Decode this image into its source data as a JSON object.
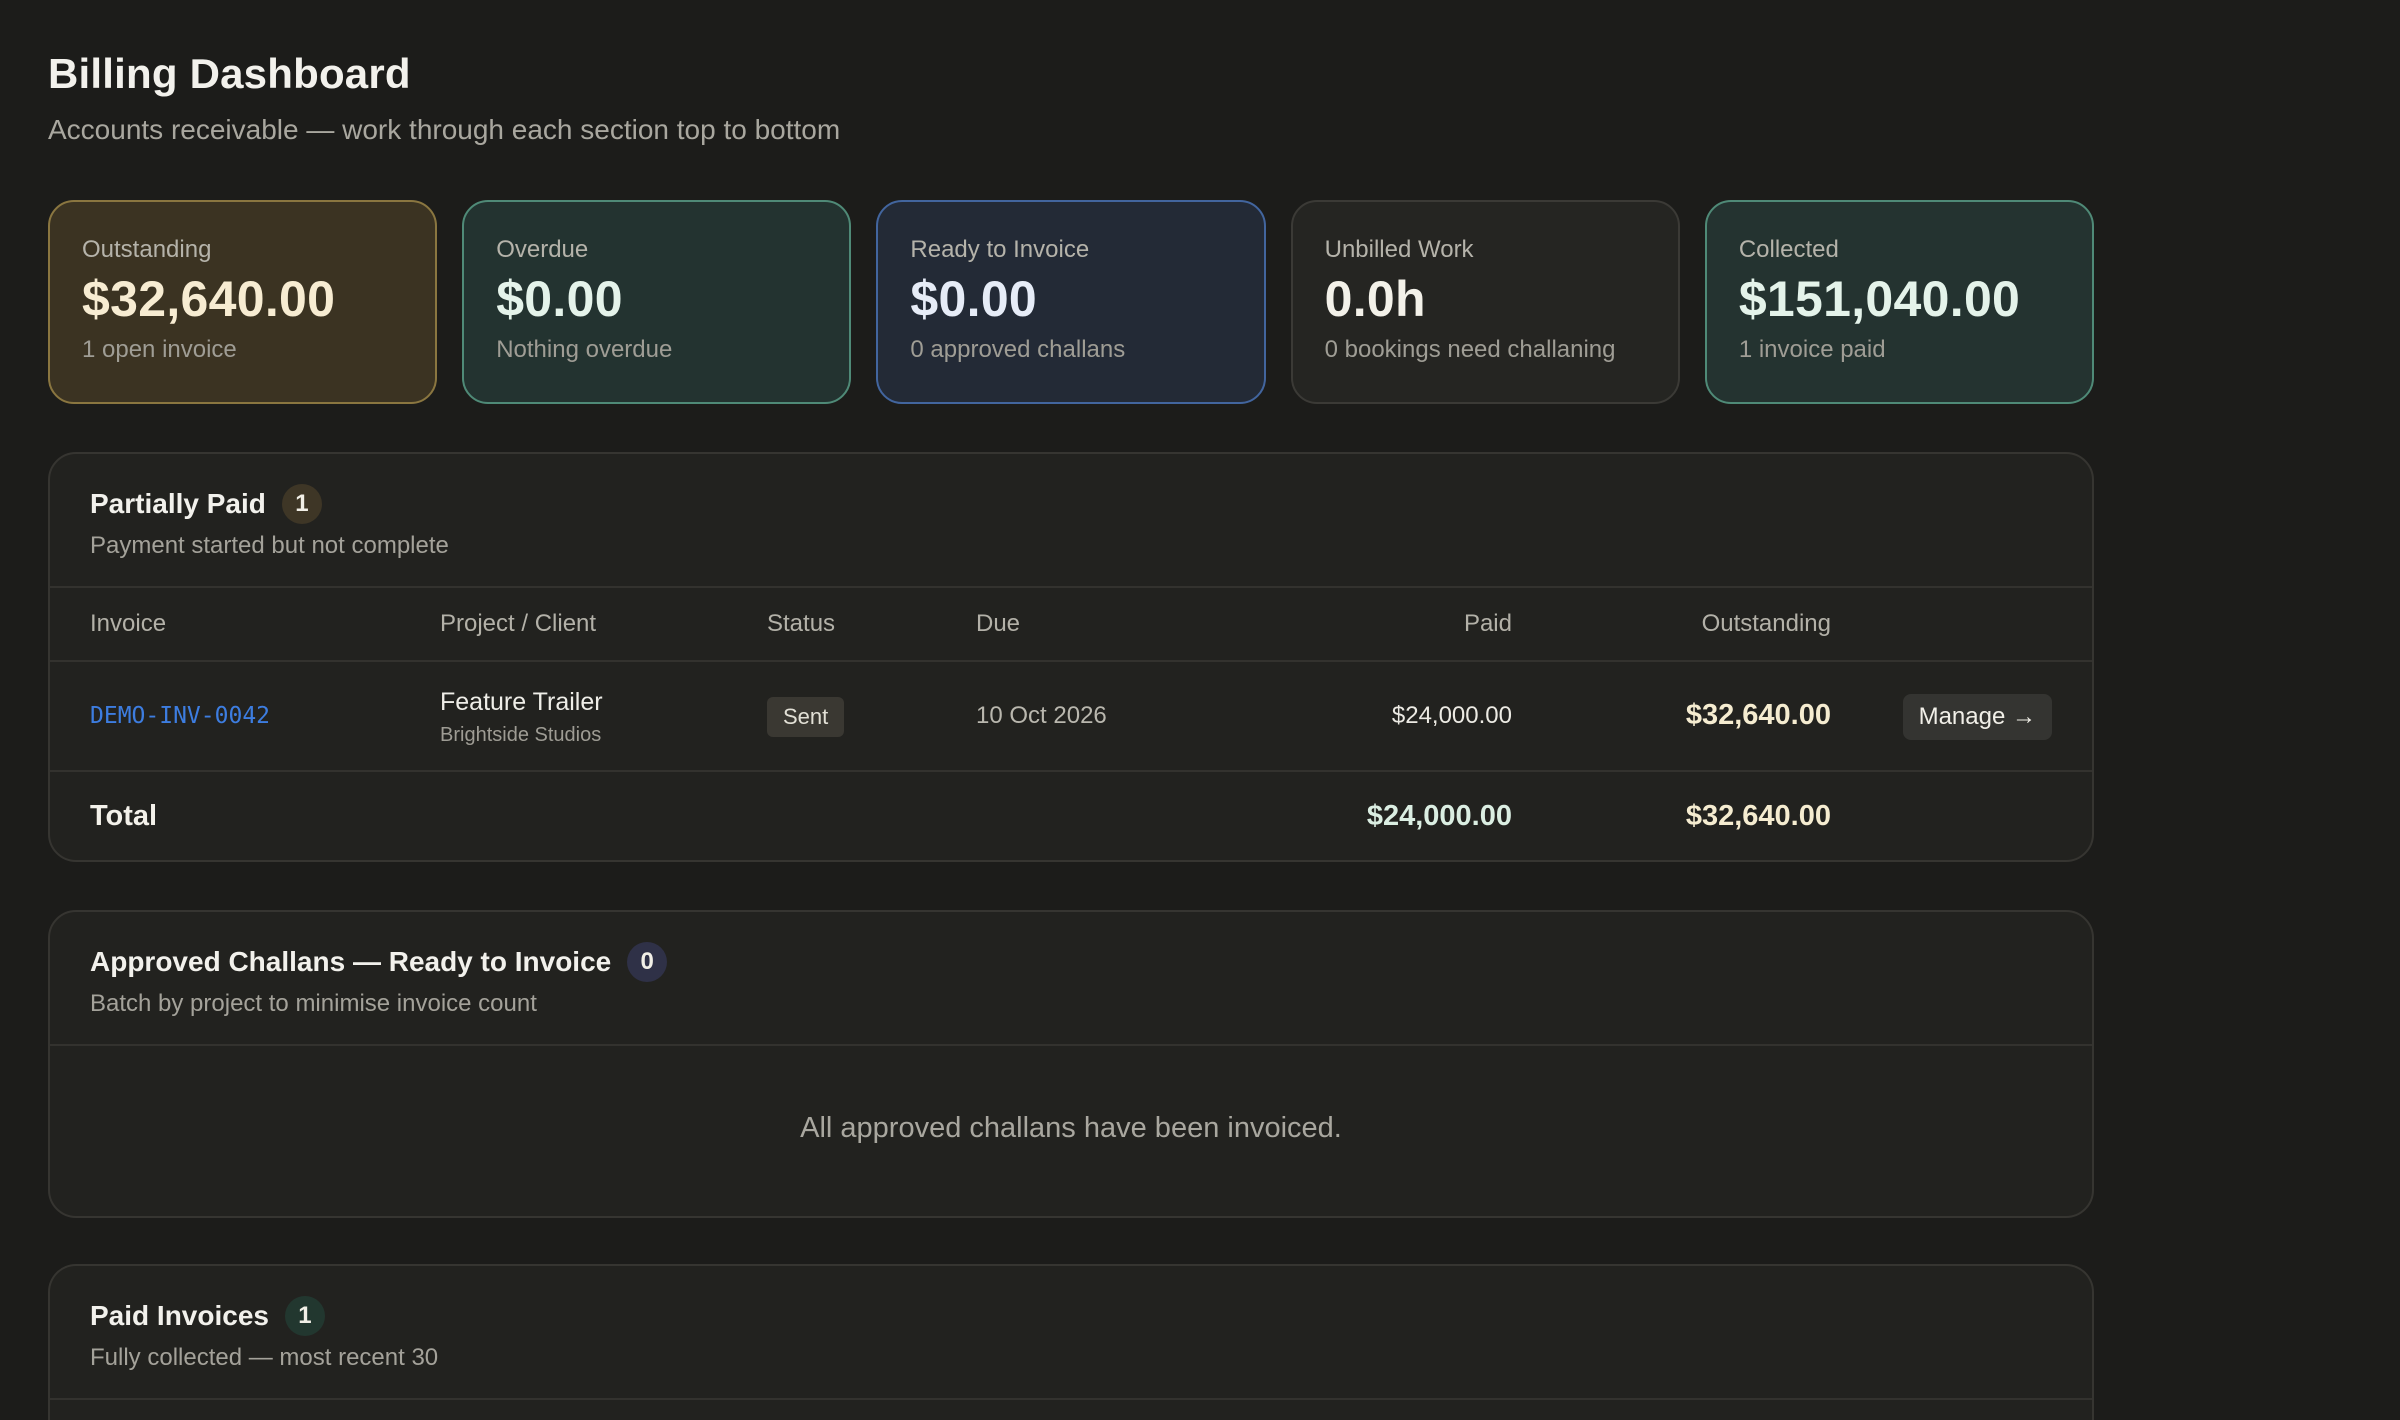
{
  "header": {
    "title": "Billing Dashboard",
    "subtitle": "Accounts receivable — work through each section top to bottom"
  },
  "summary_cards": [
    {
      "label": "Outstanding",
      "value": "$32,640.00",
      "note": "1 open invoice"
    },
    {
      "label": "Overdue",
      "value": "$0.00",
      "note": "Nothing overdue"
    },
    {
      "label": "Ready to Invoice",
      "value": "$0.00",
      "note": "0 approved challans"
    },
    {
      "label": "Unbilled Work",
      "value": "0.0h",
      "note": "0 bookings need challaning"
    },
    {
      "label": "Collected",
      "value": "$151,040.00",
      "note": "1 invoice paid"
    }
  ],
  "partially_paid": {
    "title": "Partially Paid",
    "count": "1",
    "description": "Payment started but not complete",
    "columns": {
      "invoice": "Invoice",
      "project_client": "Project / Client",
      "status": "Status",
      "due": "Due",
      "paid": "Paid",
      "outstanding": "Outstanding"
    },
    "rows": [
      {
        "invoice": "DEMO-INV-0042",
        "project": "Feature Trailer",
        "client": "Brightside Studios",
        "status": "Sent",
        "due": "10 Oct 2026",
        "paid": "$24,000.00",
        "outstanding": "$32,640.00",
        "action": "Manage →"
      }
    ],
    "total": {
      "label": "Total",
      "paid": "$24,000.00",
      "outstanding": "$32,640.00"
    }
  },
  "approved_challans": {
    "title": "Approved Challans — Ready to Invoice",
    "count": "0",
    "description": "Batch by project to minimise invoice count",
    "empty_message": "All approved challans have been invoiced."
  },
  "paid_invoices": {
    "title": "Paid Invoices",
    "count": "1",
    "description": "Fully collected — most recent 30"
  },
  "colors": {
    "background": "#1c1c1a",
    "outstanding_accent": "#8a7640",
    "success_accent": "#4f8a77",
    "info_accent": "#42659e",
    "link": "#3d7de0"
  }
}
